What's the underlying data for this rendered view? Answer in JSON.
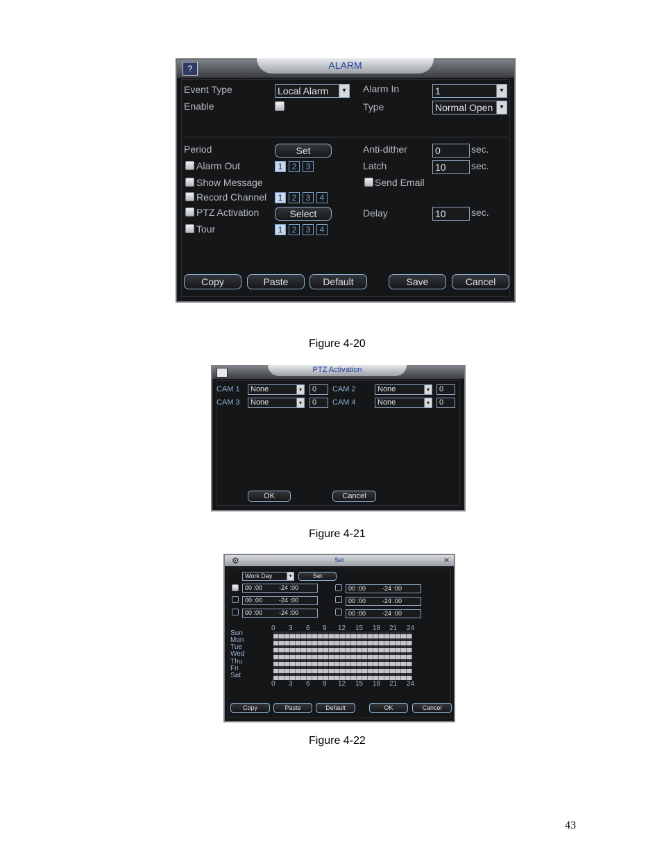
{
  "alarm": {
    "title": "ALARM",
    "event_type_label": "Event Type",
    "event_type_value": "Local Alarm",
    "enable_label": "Enable",
    "alarm_in_label": "Alarm In",
    "alarm_in_value": "1",
    "type_label": "Type",
    "type_value": "Normal Open",
    "period_label": "Period",
    "set_button": "Set",
    "anti_dither_label": "Anti-dither",
    "anti_dither_value": "0",
    "sec1": "sec.",
    "alarm_out_label": "Alarm Out",
    "alarm_out_channels": [
      "1",
      "2",
      "3"
    ],
    "latch_label": "Latch",
    "latch_value": "10",
    "sec2": "sec.",
    "show_message_label": "Show Message",
    "send_email_label": "Send Email",
    "record_channel_label": "Record Channel",
    "record_channels": [
      "1",
      "2",
      "3",
      "4"
    ],
    "ptz_activation_label": "PTZ Activation",
    "select_button": "Select",
    "delay_label": "Delay",
    "delay_value": "10",
    "sec3": "sec.",
    "tour_label": "Tour",
    "tour_channels": [
      "1",
      "2",
      "3",
      "4"
    ],
    "buttons": {
      "copy": "Copy",
      "paste": "Paste",
      "default": "Default",
      "save": "Save",
      "cancel": "Cancel"
    }
  },
  "caption1": "Figure 4-20",
  "ptz": {
    "title": "PTZ Activation",
    "cams": [
      {
        "label": "CAM 1",
        "value": "None",
        "num": "0"
      },
      {
        "label": "CAM 2",
        "value": "None",
        "num": "0"
      },
      {
        "label": "CAM 3",
        "value": "None",
        "num": "0"
      },
      {
        "label": "CAM 4",
        "value": "None",
        "num": "0"
      }
    ],
    "ok_button": "OK",
    "cancel_button": "Cancel"
  },
  "caption2": "Figure 4-21",
  "set": {
    "title": "Set",
    "day_select": "Work Day",
    "set_button": "Set",
    "periods": [
      {
        "start": "00 :00",
        "end": "-24 :00"
      },
      {
        "start": "00 :00",
        "end": "-24 :00"
      },
      {
        "start": "00 :00",
        "end": "-24 :00"
      },
      {
        "start": "00 :00",
        "end": "-24 :00"
      },
      {
        "start": "00 :00",
        "end": "-24 :00"
      },
      {
        "start": "00 :00",
        "end": "-24 :00"
      }
    ],
    "hours": [
      "0",
      "3",
      "6",
      "9",
      "12",
      "15",
      "18",
      "21",
      "24"
    ],
    "days": [
      "Sun",
      "Mon",
      "Tue",
      "Wed",
      "Thu",
      "Fri",
      "Sat"
    ],
    "buttons": {
      "copy": "Copy",
      "paste": "Paste",
      "default": "Default",
      "ok": "OK",
      "cancel": "Cancel"
    }
  },
  "caption3": "Figure 4-22",
  "page_number": "43"
}
